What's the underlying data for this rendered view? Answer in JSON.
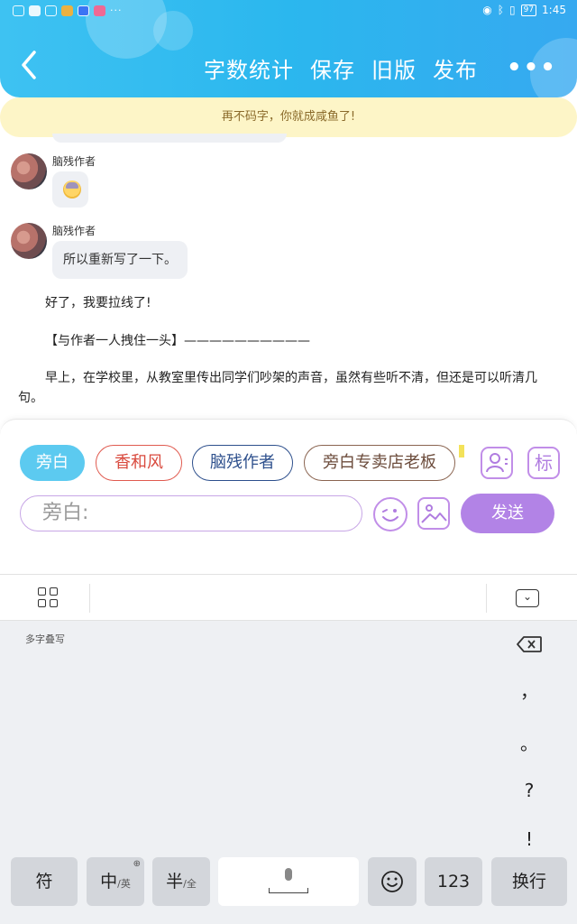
{
  "status": {
    "time": "1:45",
    "battery": "97"
  },
  "header": {
    "back_icon": "chevron-left-icon",
    "actions": [
      "字数统计",
      "保存",
      "旧版",
      "发布"
    ],
    "more": "•••"
  },
  "notice": "再不码字，你就成咸鱼了!",
  "chat": {
    "messages": [
      {
        "sender": "脑残作者",
        "type": "emoji",
        "emoji": "sweat-face-emoji"
      },
      {
        "sender": "脑残作者",
        "type": "text",
        "text": "所以重新写了一下。"
      }
    ],
    "story": [
      "好了，我要拉线了!",
      "【与作者一人拽住一头】——————————",
      "早上，在学校里，从教室里传出同学们吵架的声音，虽然有些听不清，但还是可以听清几句。"
    ]
  },
  "composer": {
    "roles": [
      "旁白",
      "香和风",
      "脑残作者",
      "旁白专卖店老板"
    ],
    "role_icon": "person-card-icon",
    "tag_icon_text": "标",
    "input_placeholder": "旁白:",
    "emoji_icon": "wink-face-icon",
    "image_icon": "image-icon",
    "send": "发送"
  },
  "keyboard": {
    "handwriting_label": "多字叠写",
    "punctuation": [
      "，",
      "。",
      "?",
      "!"
    ],
    "keys": {
      "symbol": "符",
      "chinese": "中",
      "chinese_alt": "/英",
      "half": "半",
      "half_alt": "/全",
      "numbers": "123",
      "newline": "换行"
    }
  }
}
